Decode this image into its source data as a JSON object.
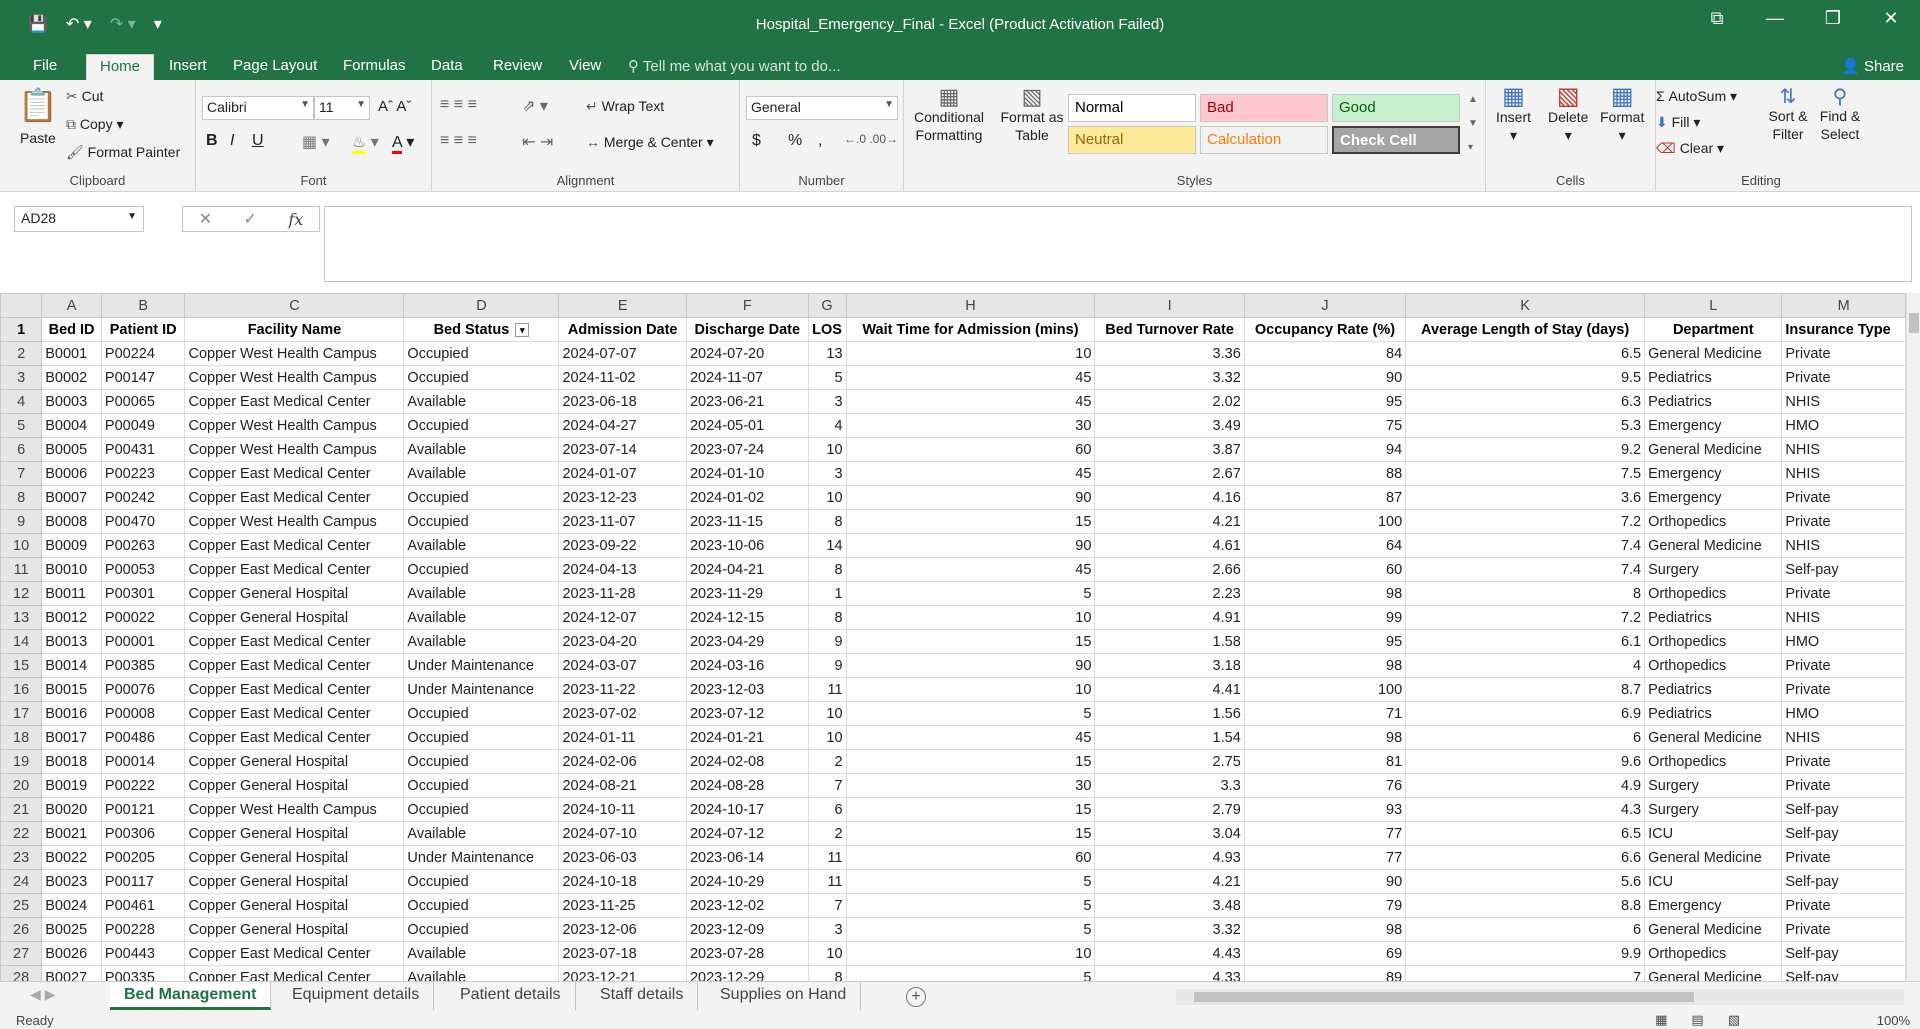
{
  "window": {
    "title": "Hospital_Emergency_Final - Excel (Product Activation Failed)",
    "controls": [
      "⧉",
      "—",
      "❐",
      "✕"
    ]
  },
  "menu": {
    "tabs": [
      "File",
      "Home",
      "Insert",
      "Page Layout",
      "Formulas",
      "Data",
      "Review",
      "View"
    ],
    "active_tab": "Home",
    "tell_me": "Tell me what you want to do...",
    "share": "Share"
  },
  "ribbon": {
    "clipboard": {
      "paste": "Paste",
      "cut": "Cut",
      "copy": "Copy",
      "format_painter": "Format Painter",
      "label": "Clipboard"
    },
    "font": {
      "name": "Calibri",
      "size": "11",
      "bold": "B",
      "italic": "I",
      "underline": "U",
      "label": "Font"
    },
    "alignment": {
      "wrap_text": "Wrap Text",
      "merge_center": "Merge & Center",
      "label": "Alignment"
    },
    "number": {
      "format": "General",
      "currency": "$",
      "percent": "%",
      "comma": ",",
      "label": "Number"
    },
    "styles": {
      "conditional": "Conditional Formatting",
      "format_table": "Format as Table",
      "cells": [
        {
          "name": "Normal",
          "bg": "#ffffff",
          "fg": "#000000"
        },
        {
          "name": "Bad",
          "bg": "#ffc7ce",
          "fg": "#9c0006"
        },
        {
          "name": "Good",
          "bg": "#c6efce",
          "fg": "#006100"
        },
        {
          "name": "Neutral",
          "bg": "#ffeb9c",
          "fg": "#9c6500"
        },
        {
          "name": "Calculation",
          "bg": "#f2f2f2",
          "fg": "#fa7d00"
        },
        {
          "name": "Check Cell",
          "bg": "#a5a5a5",
          "fg": "#ffffff"
        }
      ],
      "label": "Styles"
    },
    "cells": {
      "insert": "Insert",
      "delete": "Delete",
      "format": "Format",
      "label": "Cells"
    },
    "editing": {
      "autosum": "AutoSum",
      "fill": "Fill",
      "clear": "Clear",
      "sort_filter": "Sort & Filter",
      "find_select": "Find & Select",
      "label": "Editing"
    }
  },
  "formula_bar": {
    "name_box": "AD28",
    "fx": "fx",
    "value": ""
  },
  "sheet": {
    "columns": [
      "A",
      "B",
      "C",
      "D",
      "E",
      "F",
      "G",
      "H",
      "I",
      "J",
      "K",
      "L",
      "M"
    ],
    "headers": [
      "Bed ID",
      "Patient ID",
      "Facility Name",
      "Bed Status",
      "Admission Date",
      "Discharge Date",
      "LOS",
      "Wait Time for Admission (mins)",
      "Bed Turnover Rate",
      "Occupancy Rate (%)",
      "Average Length of Stay (days)",
      "Department",
      "Insurance Type"
    ],
    "rows": [
      [
        "B0001",
        "P00224",
        "Copper West Health Campus",
        "Occupied",
        "2024-07-07",
        "2024-07-20",
        "13",
        "10",
        "3.36",
        "84",
        "6.5",
        "General Medicine",
        "Private"
      ],
      [
        "B0002",
        "P00147",
        "Copper West Health Campus",
        "Occupied",
        "2024-11-02",
        "2024-11-07",
        "5",
        "45",
        "3.32",
        "90",
        "9.5",
        "Pediatrics",
        "Private"
      ],
      [
        "B0003",
        "P00065",
        "Copper East Medical Center",
        "Available",
        "2023-06-18",
        "2023-06-21",
        "3",
        "45",
        "2.02",
        "95",
        "6.3",
        "Pediatrics",
        "NHIS"
      ],
      [
        "B0004",
        "P00049",
        "Copper West Health Campus",
        "Occupied",
        "2024-04-27",
        "2024-05-01",
        "4",
        "30",
        "3.49",
        "75",
        "5.3",
        "Emergency",
        "HMO"
      ],
      [
        "B0005",
        "P00431",
        "Copper West Health Campus",
        "Available",
        "2023-07-14",
        "2023-07-24",
        "10",
        "60",
        "3.87",
        "94",
        "9.2",
        "General Medicine",
        "NHIS"
      ],
      [
        "B0006",
        "P00223",
        "Copper East Medical Center",
        "Available",
        "2024-01-07",
        "2024-01-10",
        "3",
        "45",
        "2.67",
        "88",
        "7.5",
        "Emergency",
        "NHIS"
      ],
      [
        "B0007",
        "P00242",
        "Copper East Medical Center",
        "Occupied",
        "2023-12-23",
        "2024-01-02",
        "10",
        "90",
        "4.16",
        "87",
        "3.6",
        "Emergency",
        "Private"
      ],
      [
        "B0008",
        "P00470",
        "Copper West Health Campus",
        "Occupied",
        "2023-11-07",
        "2023-11-15",
        "8",
        "15",
        "4.21",
        "100",
        "7.2",
        "Orthopedics",
        "Private"
      ],
      [
        "B0009",
        "P00263",
        "Copper East Medical Center",
        "Available",
        "2023-09-22",
        "2023-10-06",
        "14",
        "90",
        "4.61",
        "64",
        "7.4",
        "General Medicine",
        "NHIS"
      ],
      [
        "B0010",
        "P00053",
        "Copper East Medical Center",
        "Occupied",
        "2024-04-13",
        "2024-04-21",
        "8",
        "45",
        "2.66",
        "60",
        "7.4",
        "Surgery",
        "Self-pay"
      ],
      [
        "B0011",
        "P00301",
        "Copper General Hospital",
        "Available",
        "2023-11-28",
        "2023-11-29",
        "1",
        "5",
        "2.23",
        "98",
        "8",
        "Orthopedics",
        "Private"
      ],
      [
        "B0012",
        "P00022",
        "Copper General Hospital",
        "Available",
        "2024-12-07",
        "2024-12-15",
        "8",
        "10",
        "4.91",
        "99",
        "7.2",
        "Pediatrics",
        "NHIS"
      ],
      [
        "B0013",
        "P00001",
        "Copper East Medical Center",
        "Available",
        "2023-04-20",
        "2023-04-29",
        "9",
        "15",
        "1.58",
        "95",
        "6.1",
        "Orthopedics",
        "HMO"
      ],
      [
        "B0014",
        "P00385",
        "Copper East Medical Center",
        "Under Maintenance",
        "2024-03-07",
        "2024-03-16",
        "9",
        "90",
        "3.18",
        "98",
        "4",
        "Orthopedics",
        "Private"
      ],
      [
        "B0015",
        "P00076",
        "Copper East Medical Center",
        "Under Maintenance",
        "2023-11-22",
        "2023-12-03",
        "11",
        "10",
        "4.41",
        "100",
        "8.7",
        "Pediatrics",
        "Private"
      ],
      [
        "B0016",
        "P00008",
        "Copper East Medical Center",
        "Occupied",
        "2023-07-02",
        "2023-07-12",
        "10",
        "5",
        "1.56",
        "71",
        "6.9",
        "Pediatrics",
        "HMO"
      ],
      [
        "B0017",
        "P00486",
        "Copper East Medical Center",
        "Occupied",
        "2024-01-11",
        "2024-01-21",
        "10",
        "45",
        "1.54",
        "98",
        "6",
        "General Medicine",
        "NHIS"
      ],
      [
        "B0018",
        "P00014",
        "Copper General Hospital",
        "Occupied",
        "2024-02-06",
        "2024-02-08",
        "2",
        "15",
        "2.75",
        "81",
        "9.6",
        "Orthopedics",
        "Private"
      ],
      [
        "B0019",
        "P00222",
        "Copper General Hospital",
        "Occupied",
        "2024-08-21",
        "2024-08-28",
        "7",
        "30",
        "3.3",
        "76",
        "4.9",
        "Surgery",
        "Private"
      ],
      [
        "B0020",
        "P00121",
        "Copper West Health Campus",
        "Occupied",
        "2024-10-11",
        "2024-10-17",
        "6",
        "15",
        "2.79",
        "93",
        "4.3",
        "Surgery",
        "Self-pay"
      ],
      [
        "B0021",
        "P00306",
        "Copper General Hospital",
        "Available",
        "2024-07-10",
        "2024-07-12",
        "2",
        "15",
        "3.04",
        "77",
        "6.5",
        "ICU",
        "Self-pay"
      ],
      [
        "B0022",
        "P00205",
        "Copper General Hospital",
        "Under Maintenance",
        "2023-06-03",
        "2023-06-14",
        "11",
        "60",
        "4.93",
        "77",
        "6.6",
        "General Medicine",
        "Private"
      ],
      [
        "B0023",
        "P00117",
        "Copper General Hospital",
        "Occupied",
        "2024-10-18",
        "2024-10-29",
        "11",
        "5",
        "4.21",
        "90",
        "5.6",
        "ICU",
        "Self-pay"
      ],
      [
        "B0024",
        "P00461",
        "Copper General Hospital",
        "Occupied",
        "2023-11-25",
        "2023-12-02",
        "7",
        "5",
        "3.48",
        "79",
        "8.8",
        "Emergency",
        "Private"
      ],
      [
        "B0025",
        "P00228",
        "Copper General Hospital",
        "Occupied",
        "2023-12-06",
        "2023-12-09",
        "3",
        "5",
        "3.32",
        "98",
        "6",
        "General Medicine",
        "Private"
      ],
      [
        "B0026",
        "P00443",
        "Copper East Medical Center",
        "Available",
        "2023-07-18",
        "2023-07-28",
        "10",
        "10",
        "4.43",
        "69",
        "9.9",
        "Orthopedics",
        "Self-pay"
      ],
      [
        "B0027",
        "P00335",
        "Copper East Medical Center",
        "Available",
        "2023-12-21",
        "2023-12-29",
        "8",
        "5",
        "4.33",
        "89",
        "7",
        "General Medicine",
        "Self-pay"
      ]
    ]
  },
  "sheet_tabs": [
    "Bed Management",
    "Equipment details",
    "Patient details",
    "Staff details",
    "Supplies on Hand"
  ],
  "active_sheet": "Bed Management",
  "status": {
    "ready": "Ready",
    "zoom": "100%"
  }
}
